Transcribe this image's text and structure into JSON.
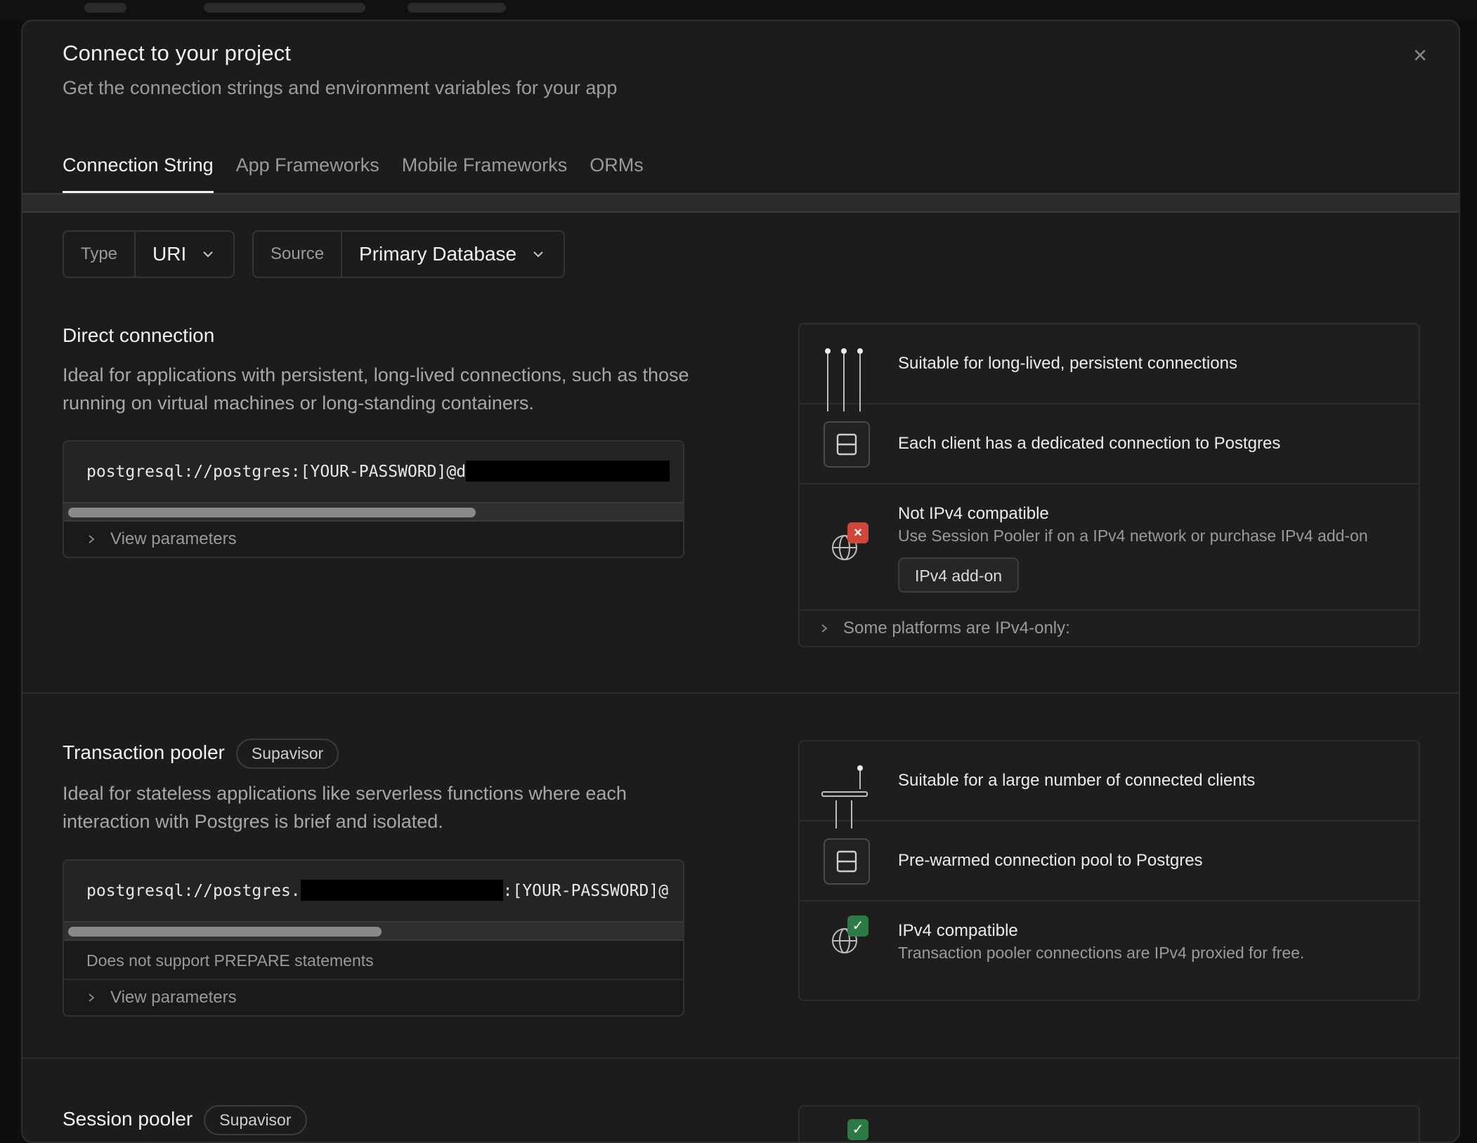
{
  "modal": {
    "title": "Connect to your project",
    "subtitle": "Get the connection strings and environment variables for your app",
    "close_icon": "×"
  },
  "tabs": [
    {
      "label": "Connection String",
      "active": true
    },
    {
      "label": "App Frameworks",
      "active": false
    },
    {
      "label": "Mobile Frameworks",
      "active": false
    },
    {
      "label": "ORMs",
      "active": false
    }
  ],
  "selectors": {
    "type": {
      "label": "Type",
      "value": "URI"
    },
    "source": {
      "label": "Source",
      "value": "Primary Database"
    }
  },
  "direct": {
    "title": "Direct connection",
    "description": "Ideal for applications with persistent, long-lived connections, such as those running on virtual machines or long-standing containers.",
    "conn_prefix": "postgresql://postgres:[YOUR-PASSWORD]@d",
    "view_params": "View parameters",
    "info": {
      "row1": "Suitable for long-lived, persistent connections",
      "row2": "Each client has a dedicated connection to Postgres",
      "row3_title": "Not IPv4 compatible",
      "row3_sub": "Use Session Pooler if on a IPv4 network or purchase IPv4 add-on",
      "addon_button": "IPv4 add-on",
      "expand": "Some platforms are IPv4-only:"
    }
  },
  "transaction": {
    "title": "Transaction pooler",
    "badge": "Supavisor",
    "description": "Ideal for stateless applications like serverless functions where each interaction with Postgres is brief and isolated.",
    "conn_prefix": "postgresql://postgres.",
    "conn_suffix": ":[YOUR-PASSWORD]@",
    "note": "Does not support PREPARE statements",
    "view_params": "View parameters",
    "info": {
      "row1": "Suitable for a large number of connected clients",
      "row2": "Pre-warmed connection pool to Postgres",
      "row3_title": "IPv4 compatible",
      "row3_sub": "Transaction pooler connections are IPv4 proxied for free."
    }
  },
  "session": {
    "title": "Session pooler",
    "badge": "Supavisor"
  },
  "colors": {
    "background": "#1c1c1c",
    "error_badge": "#d0463a",
    "success_badge": "#2d7a45"
  }
}
